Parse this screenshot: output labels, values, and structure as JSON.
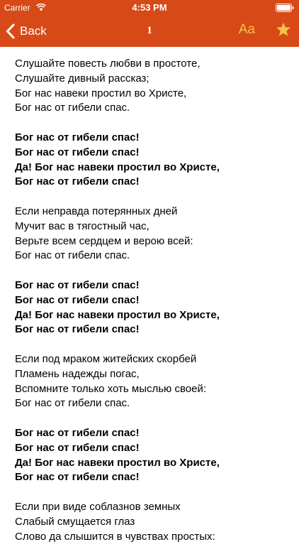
{
  "statusbar": {
    "carrier": "Carrier",
    "time": "4:53 PM"
  },
  "navbar": {
    "back_label": "Back",
    "title": "1",
    "font_label": "Aa"
  },
  "colors": {
    "bar": "#d74a17",
    "accent": "#f5c24a"
  },
  "icons": {
    "back": "chevron-left-icon",
    "star": "star-icon",
    "wifi": "wifi-icon",
    "battery": "battery-icon"
  },
  "stanzas": [
    {
      "type": "verse",
      "lines": [
        "Слушайте повесть любви в простоте,",
        "Слушайте дивный рассказ;",
        "Бог нас навеки простил во Христе,",
        "Бог нас от гибели спас."
      ]
    },
    {
      "type": "chorus",
      "lines": [
        "Бог нас от гибели спас!",
        "Бог нас от гибели спас!",
        "Да! Бог нас навеки простил во Христе,",
        "Бог нас от гибели спас!"
      ]
    },
    {
      "type": "verse",
      "lines": [
        "Если неправда потерянных дней",
        "Мучит вас в тягостный час,",
        "Верьте всем сердцем и верою всей:",
        "Бог нас от гибели спас."
      ]
    },
    {
      "type": "chorus",
      "lines": [
        "Бог нас от гибели спас!",
        "Бог нас от гибели спас!",
        "Да! Бог нас навеки простил во Христе,",
        "Бог нас от гибели спас!"
      ]
    },
    {
      "type": "verse",
      "lines": [
        "Если под мраком житейских скорбей",
        "Пламень надежды погас,",
        "Вспомните только хоть мыслью своей:",
        "Бог нас от гибели спас."
      ]
    },
    {
      "type": "chorus",
      "lines": [
        "Бог нас от гибели спас!",
        "Бог нас от гибели спас!",
        "Да! Бог нас навеки простил во Христе,",
        "Бог нас от гибели спас!"
      ]
    },
    {
      "type": "verse",
      "lines": [
        "Если при виде соблазнов земных",
        "Слабый смущается глаз",
        "Слово да слышится в чувствах простых:"
      ]
    }
  ]
}
